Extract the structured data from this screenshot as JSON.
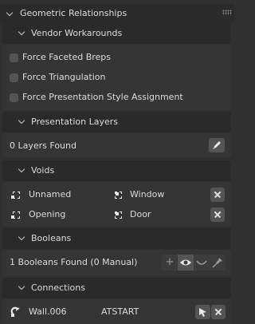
{
  "panel": {
    "title": "Geometric Relationships"
  },
  "vendor": {
    "header": "Vendor Workarounds",
    "options": [
      {
        "label": "Force Faceted Breps",
        "checked": false
      },
      {
        "label": "Force Triangulation",
        "checked": false
      },
      {
        "label": "Force Presentation Style Assignment",
        "checked": false
      }
    ]
  },
  "presentation": {
    "header": "Presentation Layers",
    "status": "0 Layers Found"
  },
  "voids": {
    "header": "Voids",
    "rows": [
      {
        "name": "Unnamed",
        "type": "Window"
      },
      {
        "name": "Opening",
        "type": "Door"
      }
    ]
  },
  "booleans": {
    "header": "Booleans",
    "status": "1 Booleans Found (0 Manual)"
  },
  "connections": {
    "header": "Connections",
    "rows": [
      {
        "element": "Wall.006",
        "connection": "ATSTART"
      }
    ]
  },
  "icons": {
    "grip": "drag-grip-icon",
    "chevron": "chevron-down-icon",
    "edit": "pencil-icon",
    "object": "object-icon",
    "close": "close-icon",
    "add": "plus-icon",
    "eye": "eye-icon",
    "boolean": "boolean-curve-icon",
    "pin": "pin-icon",
    "select": "cursor-icon",
    "wall": "link-icon"
  },
  "colors": {
    "background": "#303030",
    "button": "#545454",
    "text": "#dcdcdc"
  }
}
